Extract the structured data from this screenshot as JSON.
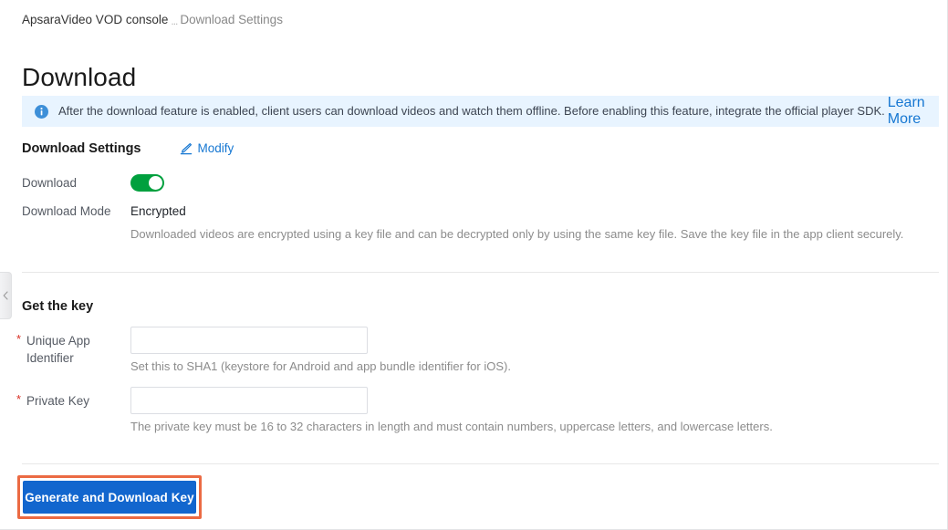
{
  "breadcrumb": {
    "root": "ApsaraVideo VOD console",
    "separator": "...",
    "current": "Download Settings"
  },
  "page": {
    "title": "Download"
  },
  "info_banner": {
    "icon": "info-circle-icon",
    "text": "After the download feature is enabled, client users can download videos and watch them offline. Before enabling this feature, integrate the official player SDK.",
    "link_label": "Learn More",
    "background_color": "#e8f4ff",
    "link_color": "#1677d2"
  },
  "download_settings": {
    "section_title": "Download Settings",
    "modify_label": "Modify",
    "modify_icon": "pencil-icon",
    "rows": {
      "download": {
        "label": "Download",
        "toggle_state": "on",
        "toggle_color": "#00a03e"
      },
      "download_mode": {
        "label": "Download Mode",
        "value": "Encrypted",
        "help": "Downloaded videos are encrypted using a key file and can be decrypted only by using the same key file. Save the key file in the app client securely."
      }
    }
  },
  "get_the_key": {
    "section_title": "Get the key",
    "required_marker": "*",
    "fields": [
      {
        "label": "Unique App Identifier",
        "value": "",
        "placeholder": "",
        "help": "Set this to SHA1 (keystore for Android and app bundle identifier for iOS).",
        "required": true
      },
      {
        "label": "Private Key",
        "value": "",
        "placeholder": "",
        "help": "The private key must be 16 to 32 characters in length and must contain numbers, uppercase letters, and lowercase letters.",
        "required": true
      }
    ]
  },
  "actions": {
    "generate_button_label": "Generate and Download Key",
    "generate_button_color": "#1266ce",
    "annotation_color": "#eb6a43"
  },
  "sidebar": {
    "collapse_icon": "chevron-left-icon"
  }
}
